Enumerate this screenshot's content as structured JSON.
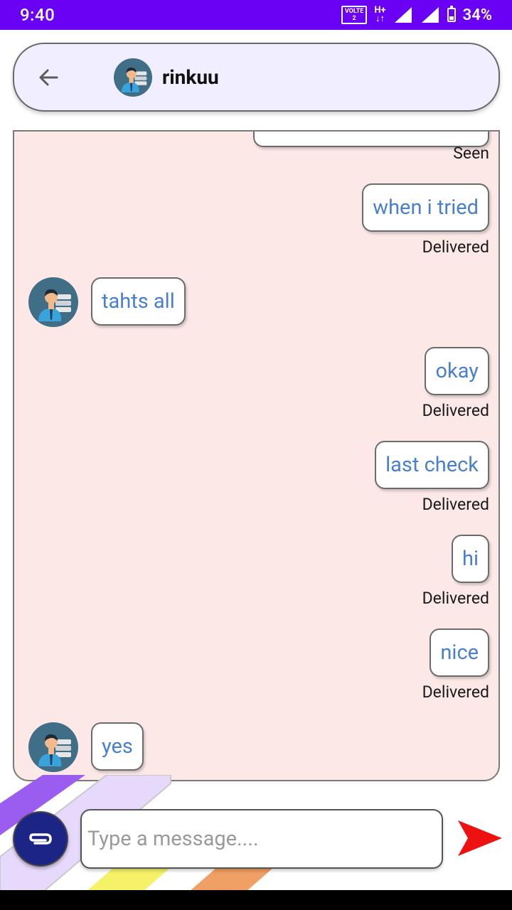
{
  "status_bar": {
    "time": "9:40",
    "volte_label": "VOLTE",
    "volte_sub": "2",
    "network_label": "H+",
    "battery_percent": "34%"
  },
  "header": {
    "back_icon": "arrow-back-icon",
    "contact_name": "rinkuu",
    "avatar_icon": "user-avatar-icon"
  },
  "messages": [
    {
      "direction": "outgoing",
      "text": "",
      "status": "Seen",
      "partial": true
    },
    {
      "direction": "outgoing",
      "text": "when i tried",
      "status": "Delivered"
    },
    {
      "direction": "incoming",
      "text": "tahts all"
    },
    {
      "direction": "outgoing",
      "text": "okay",
      "status": "Delivered"
    },
    {
      "direction": "outgoing",
      "text": "last check",
      "status": "Delivered"
    },
    {
      "direction": "outgoing",
      "text": "hi",
      "status": "Delivered"
    },
    {
      "direction": "outgoing",
      "text": "nice",
      "status": "Delivered"
    },
    {
      "direction": "incoming",
      "text": "yes"
    }
  ],
  "composer": {
    "placeholder": "Type a message....",
    "value": "",
    "attach_icon": "paperclip-icon",
    "send_icon": "send-arrow-icon"
  },
  "colors": {
    "status_bar": "#6a00f4",
    "header_bg": "#f1efff",
    "chat_bg": "#fbe8e7",
    "message_text": "#4a7fd0",
    "attach_button": "#1c2485",
    "send_arrow": "#ee1111"
  }
}
